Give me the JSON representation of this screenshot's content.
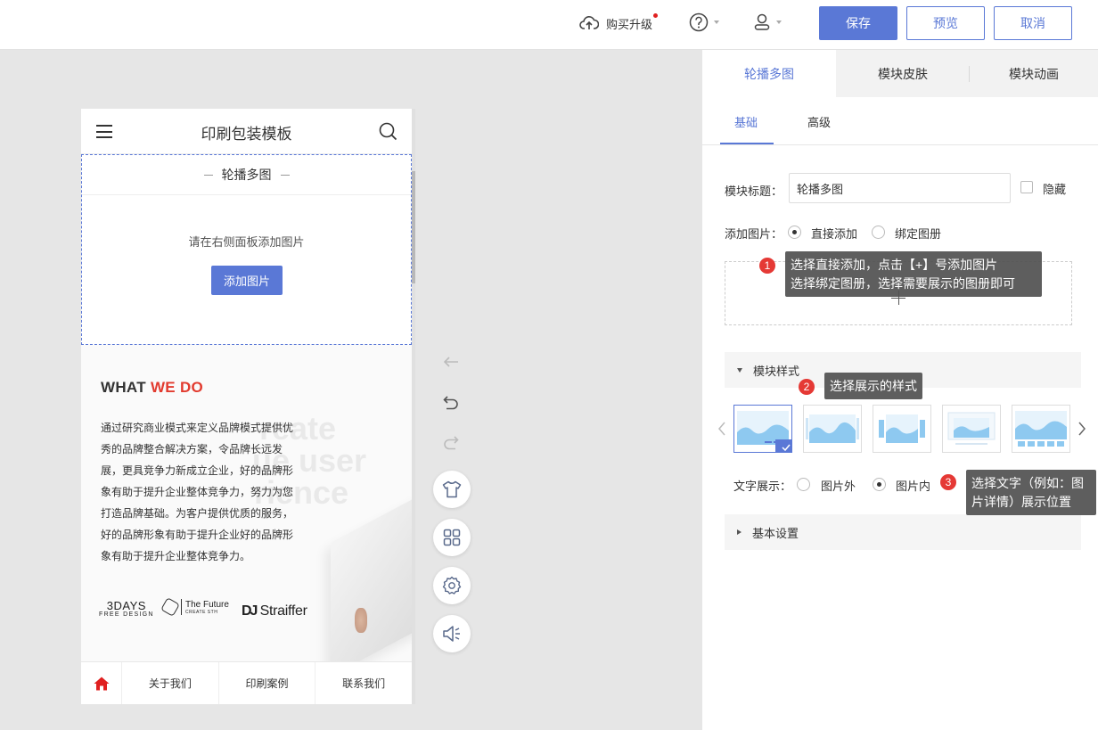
{
  "topbar": {
    "upgrade_label": "购买升级",
    "save_label": "保存",
    "preview_label": "预览",
    "cancel_label": "取消"
  },
  "phone": {
    "title": "印刷包装模板",
    "carousel": {
      "heading": "轮播多图",
      "tip": "请在右侧面板添加图片",
      "add_button": "添加图片"
    },
    "whatwedo": {
      "title_a": "WHAT ",
      "title_b": "WE DO",
      "body": "通过研究商业模式来定义品牌模式提供优秀的品牌整合解决方案，令品牌长远发展，更具竞争力新成立企业，好的品牌形象有助于提升企业整体竞争力，努力为您打造品牌基础。为客户提供优质的服务，好的品牌形象有助于提升企业好的品牌形象有助于提升企业整体竞争力。",
      "bg_line1": "reate",
      "bg_line2": "ue user",
      "bg_line3": "rience",
      "logo1_a": "3DAYS",
      "logo1_b": "FREE DESIGN",
      "logo2_a": "The Future",
      "logo2_b": "CREATE STH",
      "logo3": "Straiffer"
    },
    "nav": [
      "关于我们",
      "印刷案例",
      "联系我们"
    ]
  },
  "panel": {
    "tabs": [
      "轮播多图",
      "模块皮肤",
      "模块动画"
    ],
    "subtabs": [
      "基础",
      "高级"
    ],
    "title_label": "模块标题：",
    "title_value": "轮播多图",
    "hide_label": "隐藏",
    "add_image_label": "添加图片：",
    "add_options": [
      "直接添加",
      "绑定图册"
    ],
    "style_section": "模块样式",
    "text_display_label": "文字展示：",
    "text_options": [
      "图片外",
      "图片内"
    ],
    "basic_section": "基本设置"
  },
  "tips": {
    "t1_num": "1",
    "t1_line1": "选择直接添加，点击【+】号添加图片",
    "t1_line2": "选择绑定图册，选择需要展示的图册即可",
    "t2_num": "2",
    "t2": "选择展示的样式",
    "t3_num": "3",
    "t3_line1": "选择文字（例如：图",
    "t3_line2": "片详情）展示位置"
  },
  "colors": {
    "accent": "#5a78d6",
    "red": "#e23b2f"
  }
}
